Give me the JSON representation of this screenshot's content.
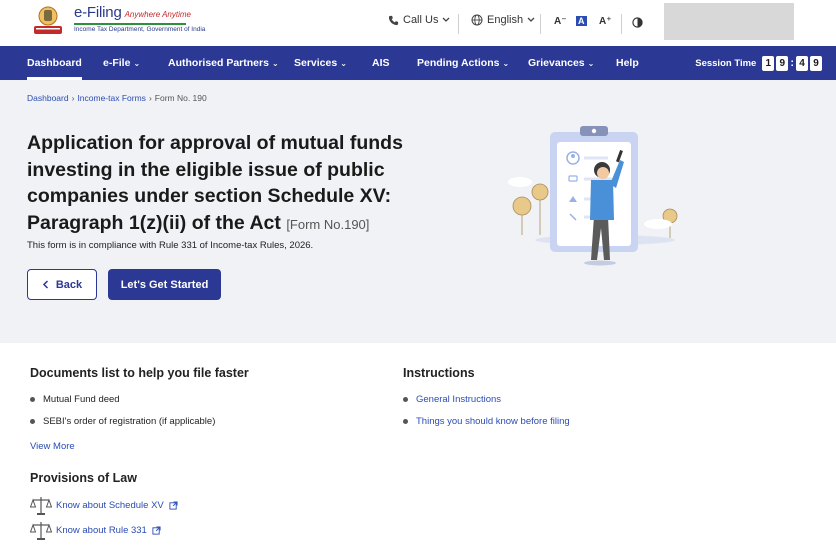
{
  "header": {
    "logo_title": "e-Filing",
    "logo_tagline": "Anywhere Anytime",
    "logo_subtitle": "Income Tax Department, Government of India",
    "call_us": "Call Us",
    "language": "English",
    "font_decrease": "A⁻",
    "font_normal": "A",
    "font_increase": "A⁺",
    "contrast_icon": "contrast-icon"
  },
  "nav": {
    "items": [
      {
        "label": "Dashboard",
        "active": true
      },
      {
        "label": "e-File",
        "caret": true
      },
      {
        "label": "Authorised Partners",
        "caret": true
      },
      {
        "label": "Services",
        "caret": true
      },
      {
        "label": "AIS"
      },
      {
        "label": "Pending Actions",
        "caret": true
      },
      {
        "label": "Grievances",
        "caret": true
      },
      {
        "label": "Help"
      }
    ],
    "session_label": "Session Time",
    "session_digits": [
      "1",
      "9",
      "4",
      "9"
    ]
  },
  "breadcrumb": {
    "items": [
      "Dashboard",
      "Income-tax Forms",
      "Form No. 190"
    ]
  },
  "hero": {
    "title": "Application for approval of mutual funds investing in the eligible issue of public companies under section Schedule XV: Paragraph 1(z)(ii) of the Act",
    "form_no": "[Form No.190]",
    "compliance": "This form is in compliance with Rule 331 of Income-tax Rules, 2026.",
    "back_label": "Back",
    "start_label": "Let's Get Started"
  },
  "documents": {
    "title": "Documents list to help you file faster",
    "items": [
      "Mutual Fund deed",
      "SEBI's order of registration (if applicable)"
    ],
    "view_more": "View More"
  },
  "instructions": {
    "title": "Instructions",
    "items": [
      "General Instructions",
      "Things you should know before filing"
    ]
  },
  "provisions": {
    "title": "Provisions of Law",
    "items": [
      "Know about Schedule XV",
      "Know about Rule 331"
    ]
  },
  "colors": {
    "nav_bg": "#2b3894",
    "link": "#2b4cb3",
    "hero_bg": "#f1f2f6"
  }
}
